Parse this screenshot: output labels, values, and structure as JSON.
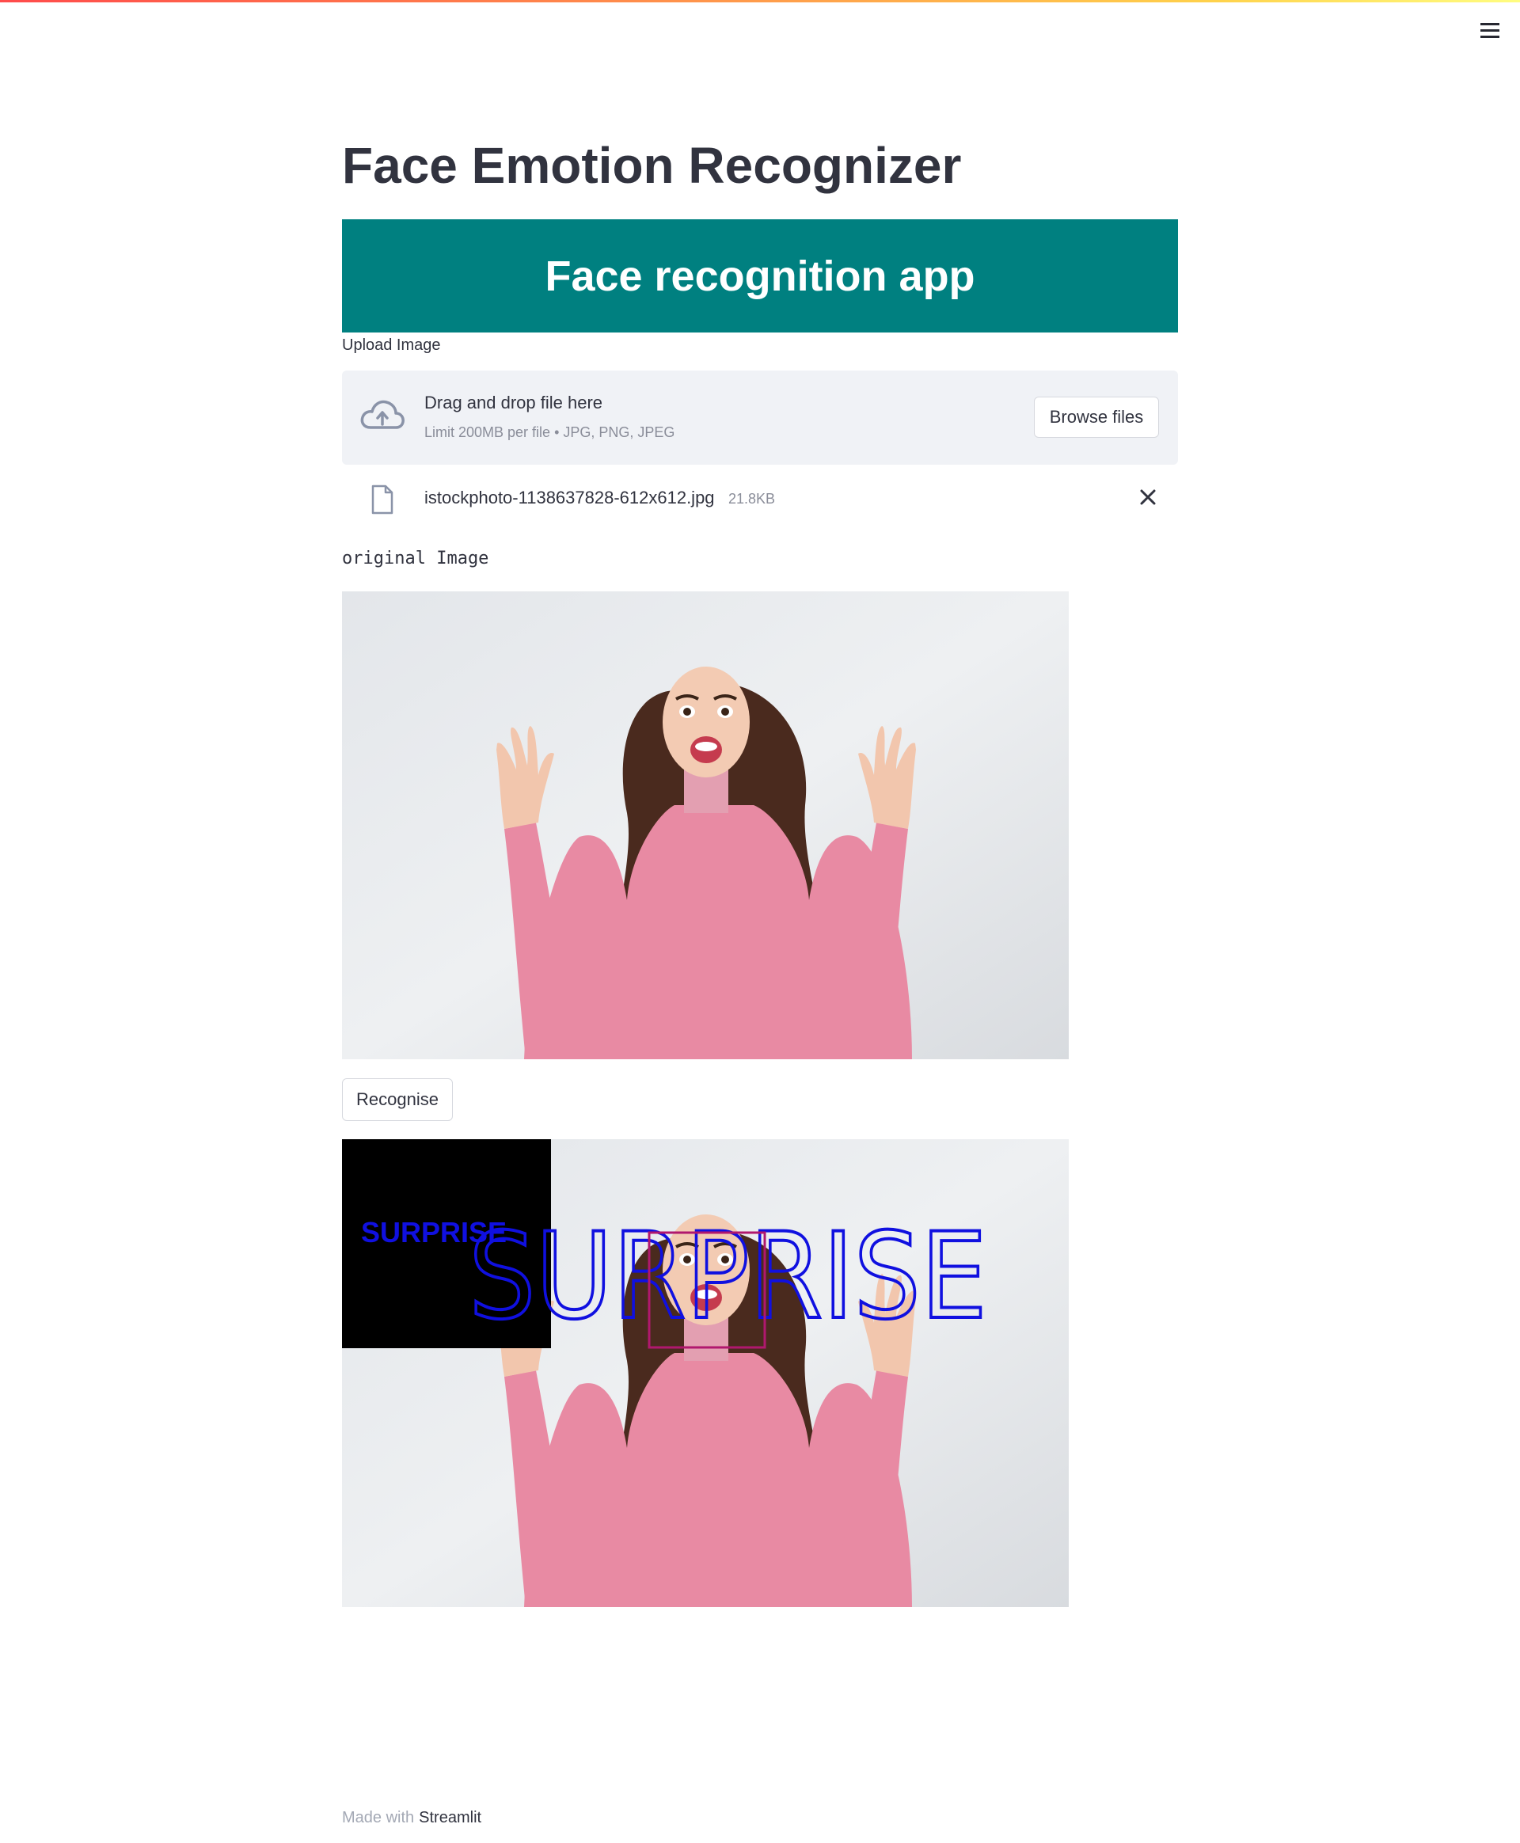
{
  "app": {
    "title": "Face Emotion Recognizer",
    "banner": "Face recognition app",
    "accent_color": "#008080"
  },
  "header": {
    "menu_icon": "hamburger-icon"
  },
  "uploader": {
    "label": "Upload Image",
    "drop_text": "Drag and drop file here",
    "limit_text": "Limit 200MB per file • JPG, PNG, JPEG",
    "browse_label": "Browse files",
    "icon": "cloud-upload-icon"
  },
  "file": {
    "name": "istockphoto-1138637828-612x612.jpg",
    "size": "21.8KB",
    "icon": "file-icon",
    "remove_icon": "close-icon"
  },
  "original": {
    "label": "original Image"
  },
  "action": {
    "recognise_label": "Recognise"
  },
  "result": {
    "emotion_small": "SURPRISE",
    "emotion_large": "SURPRISE",
    "box_color": "#b0186e",
    "text_color": "#1010e0"
  },
  "footer": {
    "made_with": "Made with",
    "brand": "Streamlit"
  }
}
